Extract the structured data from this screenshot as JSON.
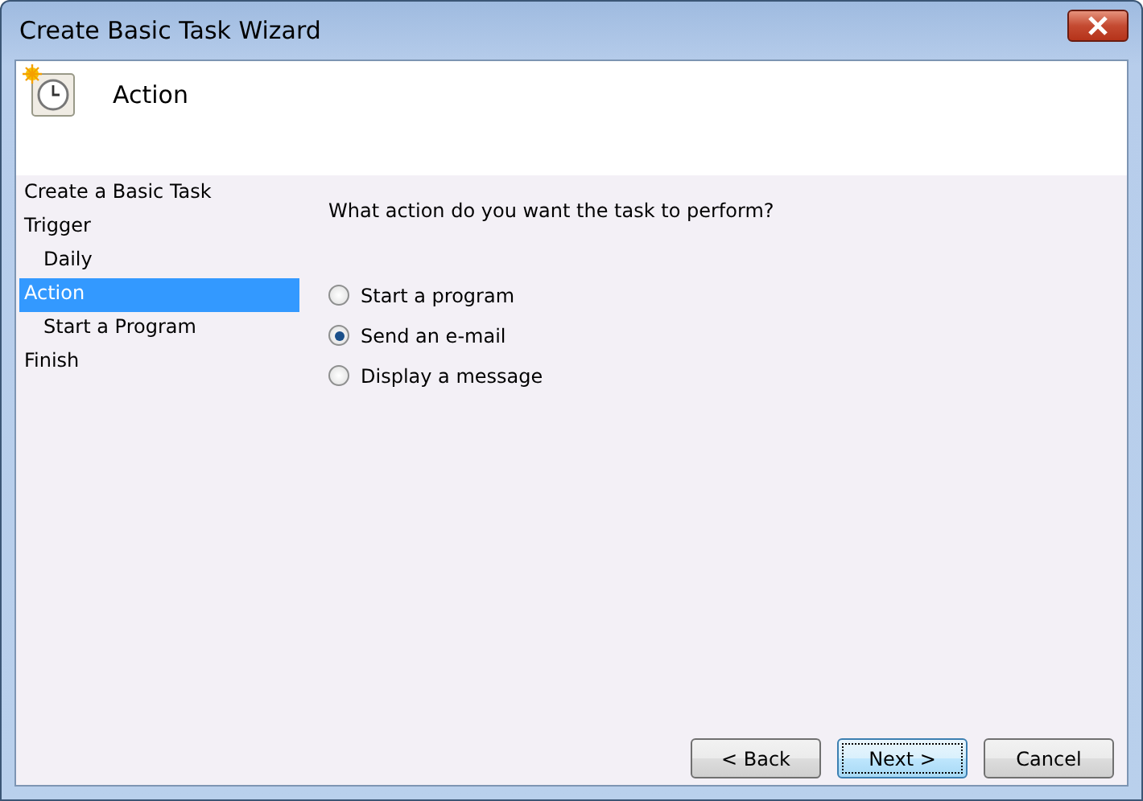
{
  "window": {
    "title": "Create Basic Task Wizard"
  },
  "header": {
    "title": "Action"
  },
  "sidebar": {
    "items": [
      {
        "label": "Create a Basic Task",
        "selected": false
      },
      {
        "label": "Trigger",
        "selected": false,
        "children": [
          {
            "label": "Daily",
            "selected": false
          }
        ]
      },
      {
        "label": "Action",
        "selected": true,
        "children": [
          {
            "label": "Start a Program",
            "selected": false
          }
        ]
      },
      {
        "label": "Finish",
        "selected": false
      }
    ]
  },
  "question": "What action do you want the task to perform?",
  "options": [
    {
      "label": "Start a program",
      "selected": false
    },
    {
      "label": "Send an e-mail",
      "selected": true
    },
    {
      "label": "Display a message",
      "selected": false
    }
  ],
  "buttons": [
    {
      "label": "< Back",
      "default": false
    },
    {
      "label": "Next >",
      "default": true
    },
    {
      "label": "Cancel",
      "default": false
    }
  ]
}
